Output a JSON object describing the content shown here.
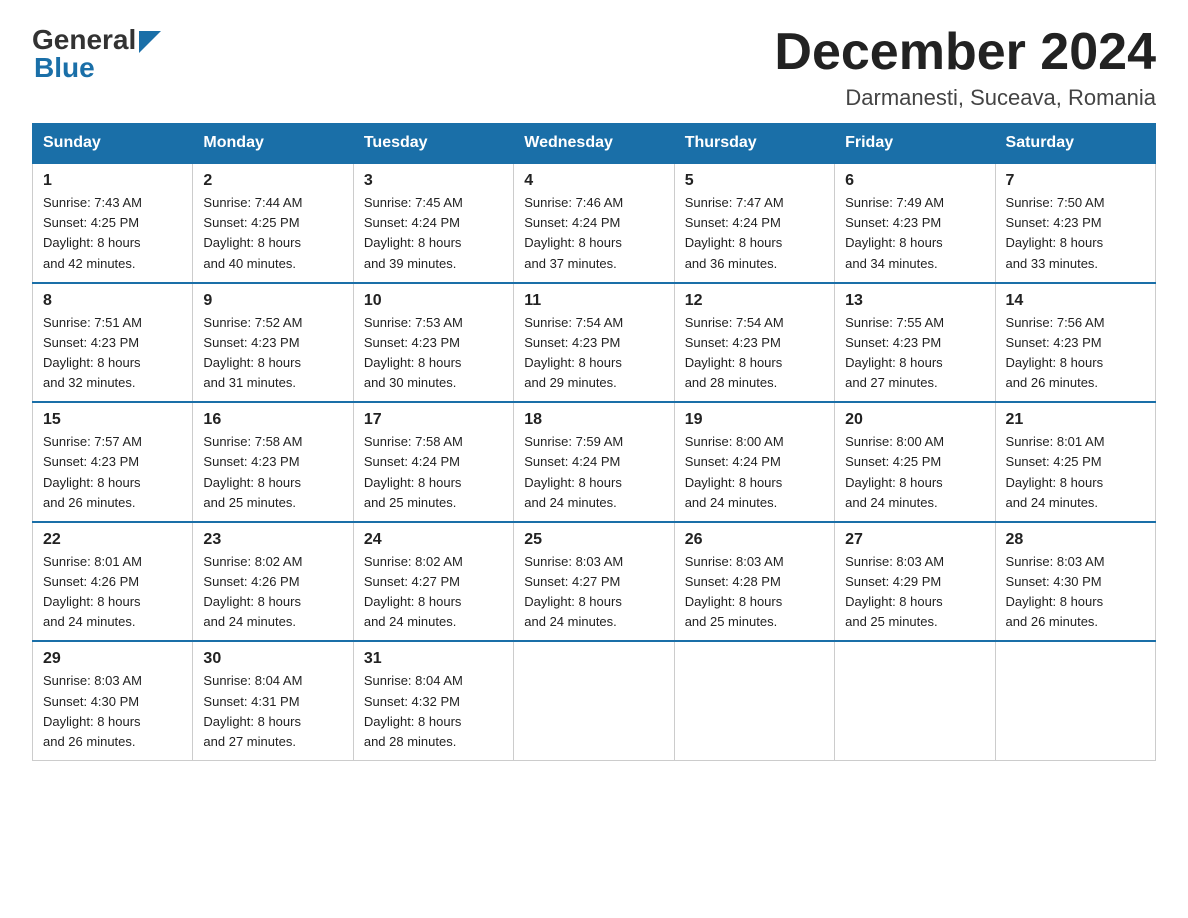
{
  "header": {
    "logo_general": "General",
    "logo_blue": "Blue",
    "month_title": "December 2024",
    "location": "Darmanesti, Suceava, Romania"
  },
  "weekdays": [
    "Sunday",
    "Monday",
    "Tuesday",
    "Wednesday",
    "Thursday",
    "Friday",
    "Saturday"
  ],
  "weeks": [
    [
      {
        "day": "1",
        "sunrise": "7:43 AM",
        "sunset": "4:25 PM",
        "daylight": "8 hours and 42 minutes."
      },
      {
        "day": "2",
        "sunrise": "7:44 AM",
        "sunset": "4:25 PM",
        "daylight": "8 hours and 40 minutes."
      },
      {
        "day": "3",
        "sunrise": "7:45 AM",
        "sunset": "4:24 PM",
        "daylight": "8 hours and 39 minutes."
      },
      {
        "day": "4",
        "sunrise": "7:46 AM",
        "sunset": "4:24 PM",
        "daylight": "8 hours and 37 minutes."
      },
      {
        "day": "5",
        "sunrise": "7:47 AM",
        "sunset": "4:24 PM",
        "daylight": "8 hours and 36 minutes."
      },
      {
        "day": "6",
        "sunrise": "7:49 AM",
        "sunset": "4:23 PM",
        "daylight": "8 hours and 34 minutes."
      },
      {
        "day": "7",
        "sunrise": "7:50 AM",
        "sunset": "4:23 PM",
        "daylight": "8 hours and 33 minutes."
      }
    ],
    [
      {
        "day": "8",
        "sunrise": "7:51 AM",
        "sunset": "4:23 PM",
        "daylight": "8 hours and 32 minutes."
      },
      {
        "day": "9",
        "sunrise": "7:52 AM",
        "sunset": "4:23 PM",
        "daylight": "8 hours and 31 minutes."
      },
      {
        "day": "10",
        "sunrise": "7:53 AM",
        "sunset": "4:23 PM",
        "daylight": "8 hours and 30 minutes."
      },
      {
        "day": "11",
        "sunrise": "7:54 AM",
        "sunset": "4:23 PM",
        "daylight": "8 hours and 29 minutes."
      },
      {
        "day": "12",
        "sunrise": "7:54 AM",
        "sunset": "4:23 PM",
        "daylight": "8 hours and 28 minutes."
      },
      {
        "day": "13",
        "sunrise": "7:55 AM",
        "sunset": "4:23 PM",
        "daylight": "8 hours and 27 minutes."
      },
      {
        "day": "14",
        "sunrise": "7:56 AM",
        "sunset": "4:23 PM",
        "daylight": "8 hours and 26 minutes."
      }
    ],
    [
      {
        "day": "15",
        "sunrise": "7:57 AM",
        "sunset": "4:23 PM",
        "daylight": "8 hours and 26 minutes."
      },
      {
        "day": "16",
        "sunrise": "7:58 AM",
        "sunset": "4:23 PM",
        "daylight": "8 hours and 25 minutes."
      },
      {
        "day": "17",
        "sunrise": "7:58 AM",
        "sunset": "4:24 PM",
        "daylight": "8 hours and 25 minutes."
      },
      {
        "day": "18",
        "sunrise": "7:59 AM",
        "sunset": "4:24 PM",
        "daylight": "8 hours and 24 minutes."
      },
      {
        "day": "19",
        "sunrise": "8:00 AM",
        "sunset": "4:24 PM",
        "daylight": "8 hours and 24 minutes."
      },
      {
        "day": "20",
        "sunrise": "8:00 AM",
        "sunset": "4:25 PM",
        "daylight": "8 hours and 24 minutes."
      },
      {
        "day": "21",
        "sunrise": "8:01 AM",
        "sunset": "4:25 PM",
        "daylight": "8 hours and 24 minutes."
      }
    ],
    [
      {
        "day": "22",
        "sunrise": "8:01 AM",
        "sunset": "4:26 PM",
        "daylight": "8 hours and 24 minutes."
      },
      {
        "day": "23",
        "sunrise": "8:02 AM",
        "sunset": "4:26 PM",
        "daylight": "8 hours and 24 minutes."
      },
      {
        "day": "24",
        "sunrise": "8:02 AM",
        "sunset": "4:27 PM",
        "daylight": "8 hours and 24 minutes."
      },
      {
        "day": "25",
        "sunrise": "8:03 AM",
        "sunset": "4:27 PM",
        "daylight": "8 hours and 24 minutes."
      },
      {
        "day": "26",
        "sunrise": "8:03 AM",
        "sunset": "4:28 PM",
        "daylight": "8 hours and 25 minutes."
      },
      {
        "day": "27",
        "sunrise": "8:03 AM",
        "sunset": "4:29 PM",
        "daylight": "8 hours and 25 minutes."
      },
      {
        "day": "28",
        "sunrise": "8:03 AM",
        "sunset": "4:30 PM",
        "daylight": "8 hours and 26 minutes."
      }
    ],
    [
      {
        "day": "29",
        "sunrise": "8:03 AM",
        "sunset": "4:30 PM",
        "daylight": "8 hours and 26 minutes."
      },
      {
        "day": "30",
        "sunrise": "8:04 AM",
        "sunset": "4:31 PM",
        "daylight": "8 hours and 27 minutes."
      },
      {
        "day": "31",
        "sunrise": "8:04 AM",
        "sunset": "4:32 PM",
        "daylight": "8 hours and 28 minutes."
      },
      {
        "day": "",
        "sunrise": "",
        "sunset": "",
        "daylight": ""
      },
      {
        "day": "",
        "sunrise": "",
        "sunset": "",
        "daylight": ""
      },
      {
        "day": "",
        "sunrise": "",
        "sunset": "",
        "daylight": ""
      },
      {
        "day": "",
        "sunrise": "",
        "sunset": "",
        "daylight": ""
      }
    ]
  ]
}
